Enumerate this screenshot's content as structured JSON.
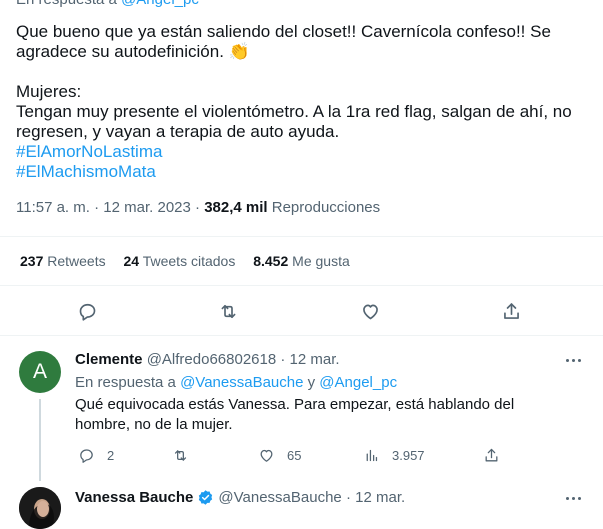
{
  "main_tweet": {
    "reply_prefix": "En respuesta a",
    "reply_handle": "@Angel_pc",
    "text_lines": [
      "Que bueno que ya están saliendo del closet!! Cavernícola confeso!! Se",
      "agradece su autodefinición.",
      "",
      "Mujeres:",
      "Tengan muy presente el violentómetro. A la 1ra red flag, salgan de ahí, no",
      "regresen, y vayan a terapia de auto ayuda."
    ],
    "clap_emoji": "👏",
    "hashtags": [
      "#ElAmorNoLastima",
      "#ElMachismoMata"
    ],
    "time": "11:57 a. m.",
    "date": "12 mar. 2023",
    "views": "382,4 mil",
    "views_label": "Reproducciones",
    "stats": {
      "retweets": "237",
      "retweets_label": "Retweets",
      "quotes": "24",
      "quotes_label": "Tweets citados",
      "likes": "8.452",
      "likes_label": "Me gusta"
    }
  },
  "reply": {
    "avatar_letter": "A",
    "avatar_color": "#2f7b3e",
    "name": "Clemente",
    "handle": "@Alfredo66802618",
    "date": "12 mar.",
    "reply_prefix": "En respuesta a",
    "reply_handle_1": "@VanessaBauche",
    "reply_and": "y",
    "reply_handle_2": "@Angel_pc",
    "text_line_1": "Qué equivocada estás Vanessa. Para empezar, está hablando del",
    "text_line_2": "hombre, no de la mujer.",
    "replies": "2",
    "retweets": "",
    "likes": "65",
    "views": "3.957"
  },
  "next_tweet": {
    "name": "Vanessa Bauche",
    "handle": "@VanessaBauche",
    "date": "12 mar.",
    "verified_color": "#1d9bf0"
  },
  "icons": [
    "reply-icon",
    "retweet-icon",
    "like-icon",
    "share-icon",
    "views-icon",
    "more-icon",
    "verified-icon"
  ]
}
